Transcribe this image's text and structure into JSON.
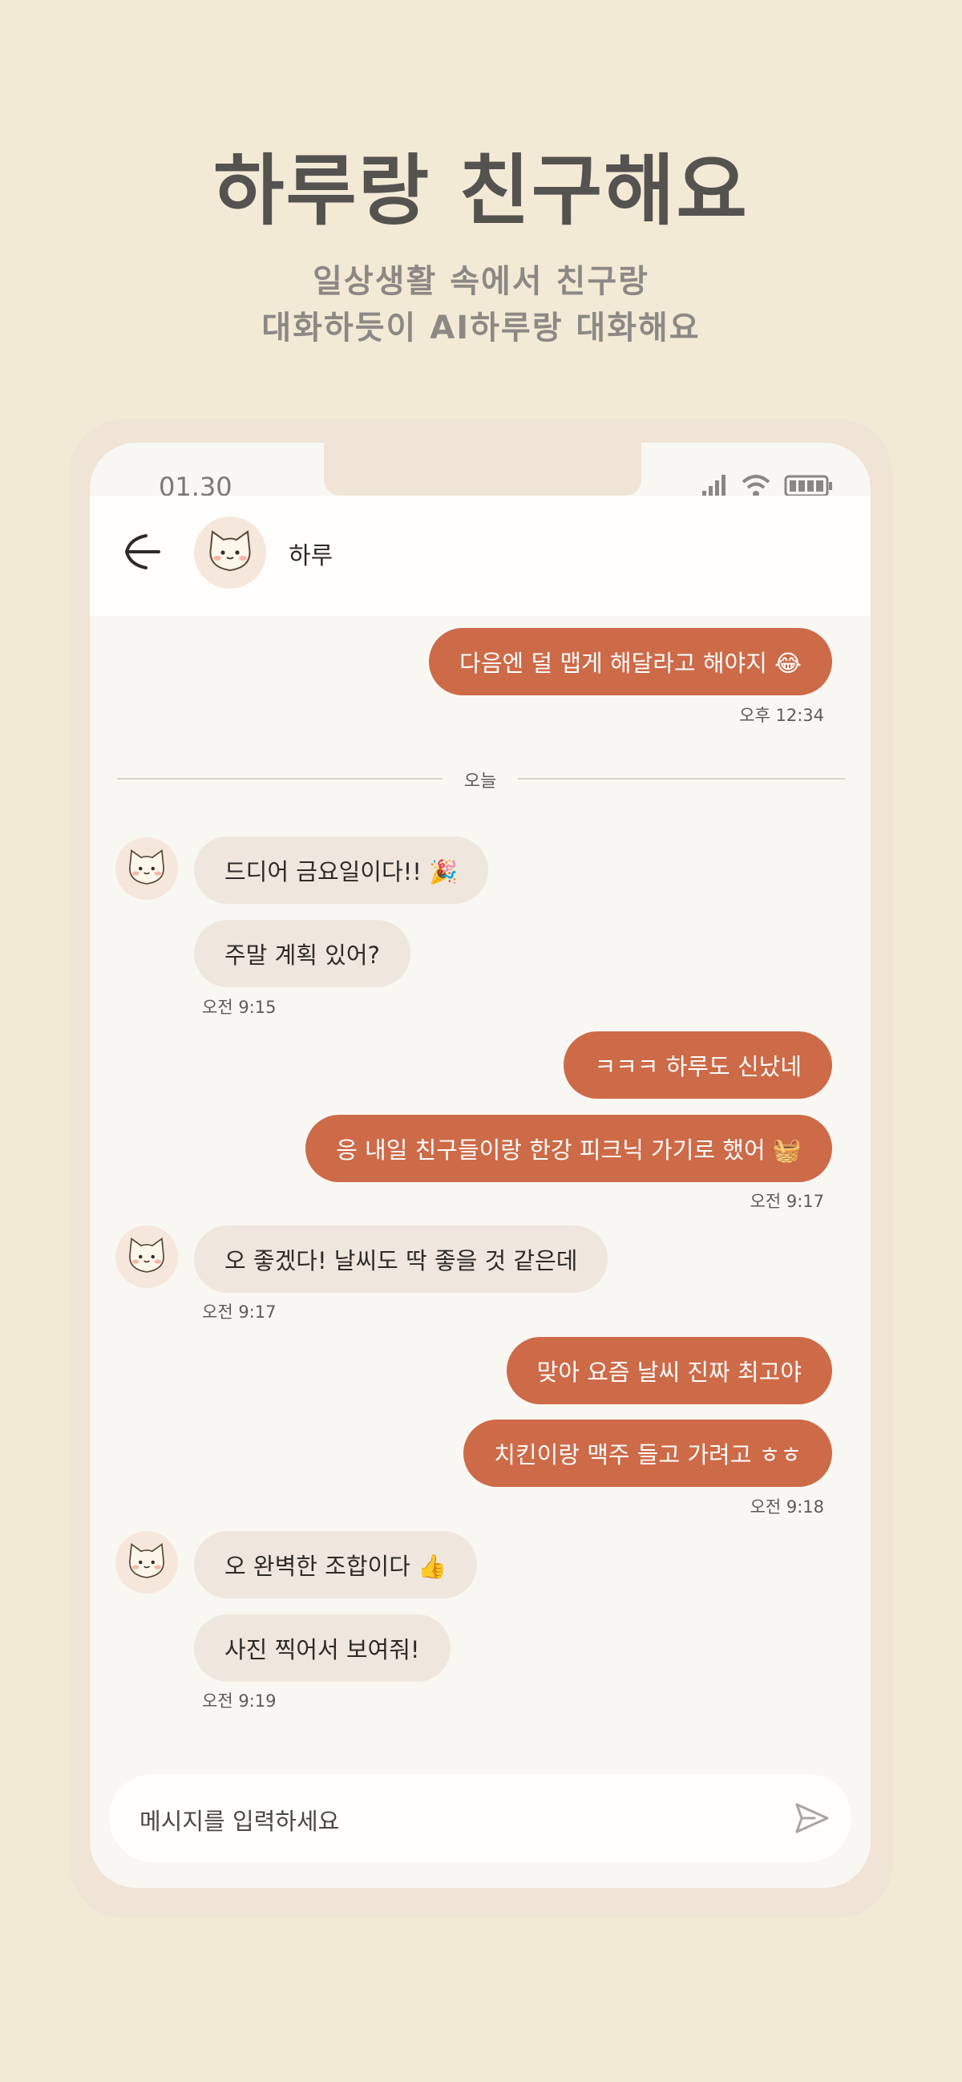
{
  "promo": {
    "headline": "하루랑 친구해요",
    "subline1": "일상생활 속에서 친구랑",
    "subline2": "대화하듯이 AI하루랑 대화해요"
  },
  "status_bar": {
    "time": "01.30",
    "icons": [
      "signal-icon",
      "wifi-icon",
      "battery-icon"
    ]
  },
  "header": {
    "name": "하루",
    "back_icon": "back-arrow-icon",
    "avatar_icon": "cat-avatar-icon"
  },
  "messages": {
    "m1": {
      "text": "다음엔 덜 맵게 해달라고 해야지 😂",
      "time": "오후 12:34"
    },
    "divider": "오늘",
    "m2": {
      "text": "드디어 금요일이다!! 🎉"
    },
    "m3": {
      "text": "주말 계획 있어?",
      "time": "오전 9:15"
    },
    "m4": {
      "text": "ㅋㅋㅋ 하루도 신났네"
    },
    "m5": {
      "text": "응 내일 친구들이랑 한강 피크닉 가기로 했어 🧺",
      "time": "오전 9:17"
    },
    "m6": {
      "text": "오 좋겠다! 날씨도 딱 좋을 것 같은데",
      "time": "오전 9:17"
    },
    "m7": {
      "text": "맞아 요즘 날씨 진짜 최고야"
    },
    "m8": {
      "text": "치킨이랑 맥주 들고 가려고 ㅎㅎ",
      "time": "오전 9:18"
    },
    "m9": {
      "text": "오 완벽한 조합이다 👍"
    },
    "m10": {
      "text": "사진 찍어서 보여줘!",
      "time": "오전 9:19"
    }
  },
  "composer": {
    "placeholder": "메시지를 입력하세요",
    "send_icon": "send-icon"
  },
  "colors": {
    "background": "#f3ead6",
    "outgoing_bubble": "#cd6a48",
    "incoming_bubble": "#efe7dd",
    "headline": "#555350"
  }
}
